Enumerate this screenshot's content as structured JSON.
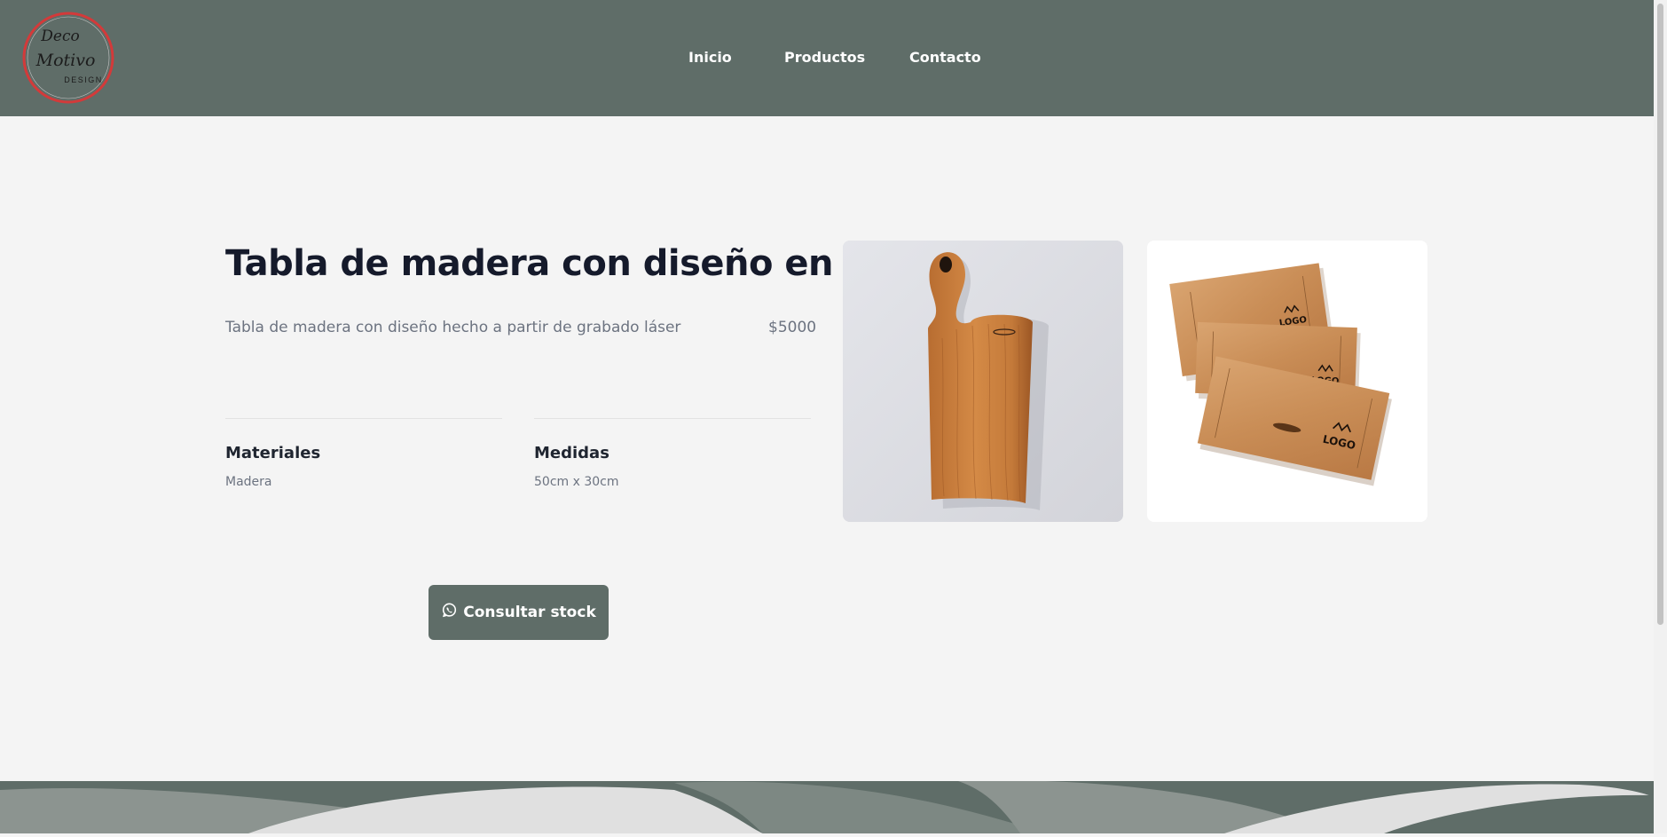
{
  "brand": {
    "logo_text_line1": "Deco",
    "logo_text_line2": "Motivo",
    "logo_text_line3": "DESIGN"
  },
  "nav": {
    "items": [
      {
        "label": "Inicio"
      },
      {
        "label": "Productos"
      },
      {
        "label": "Contacto"
      }
    ]
  },
  "product": {
    "title": "Tabla de madera con diseño en láser",
    "description": "Tabla de madera con diseño hecho a partir de grabado láser",
    "price": "$5000",
    "specs": [
      {
        "label": "Materiales",
        "value": "Madera"
      },
      {
        "label": "Medidas",
        "value": "50cm x 30cm"
      }
    ],
    "cta_label": "Consultar stock",
    "images": [
      {
        "alt": "cutting-board-photo"
      },
      {
        "alt": "engraved-boards-photo",
        "engraving_text": "LOGO"
      }
    ]
  },
  "colors": {
    "nav_bg": "#5f6d68",
    "page_bg": "#f4f4f4",
    "title": "#151a2b",
    "muted_text": "#6c7380",
    "button_bg": "#5f6d68",
    "logo_ring": "#d33a3a"
  },
  "icons": {
    "cta_icon": "whatsapp-icon"
  }
}
